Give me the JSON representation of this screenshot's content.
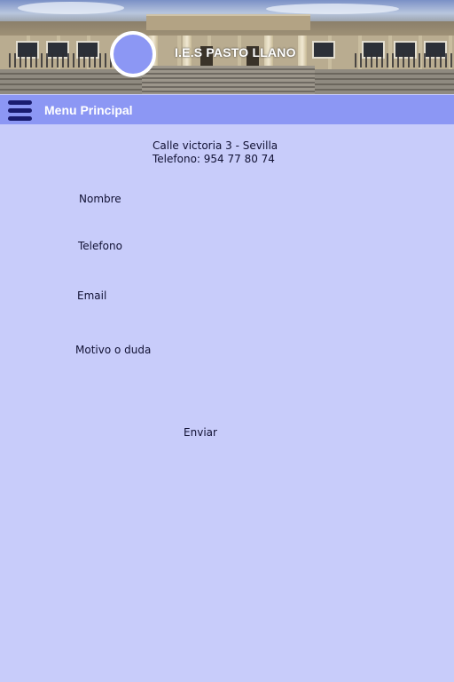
{
  "header": {
    "school_name": "I.E.S PASTO LLANO"
  },
  "menubar": {
    "title": "Menu Principal",
    "menu_icon": "hamburger-menu-icon"
  },
  "contact": {
    "address": "Calle victoria 3 - Sevilla",
    "phone": "Telefono: 954 77 80 74"
  },
  "form": {
    "fields": [
      {
        "label": "Nombre",
        "value": ""
      },
      {
        "label": "Telefono",
        "value": ""
      },
      {
        "label": "Email",
        "value": ""
      },
      {
        "label": "Motivo o duda",
        "value": ""
      }
    ],
    "submit_label": "Enviar"
  },
  "colors": {
    "background": "#c8ccfa",
    "menubar": "#8c97f4",
    "logo_fill": "#8c97f4",
    "hamburger": "#1a1c6f"
  }
}
